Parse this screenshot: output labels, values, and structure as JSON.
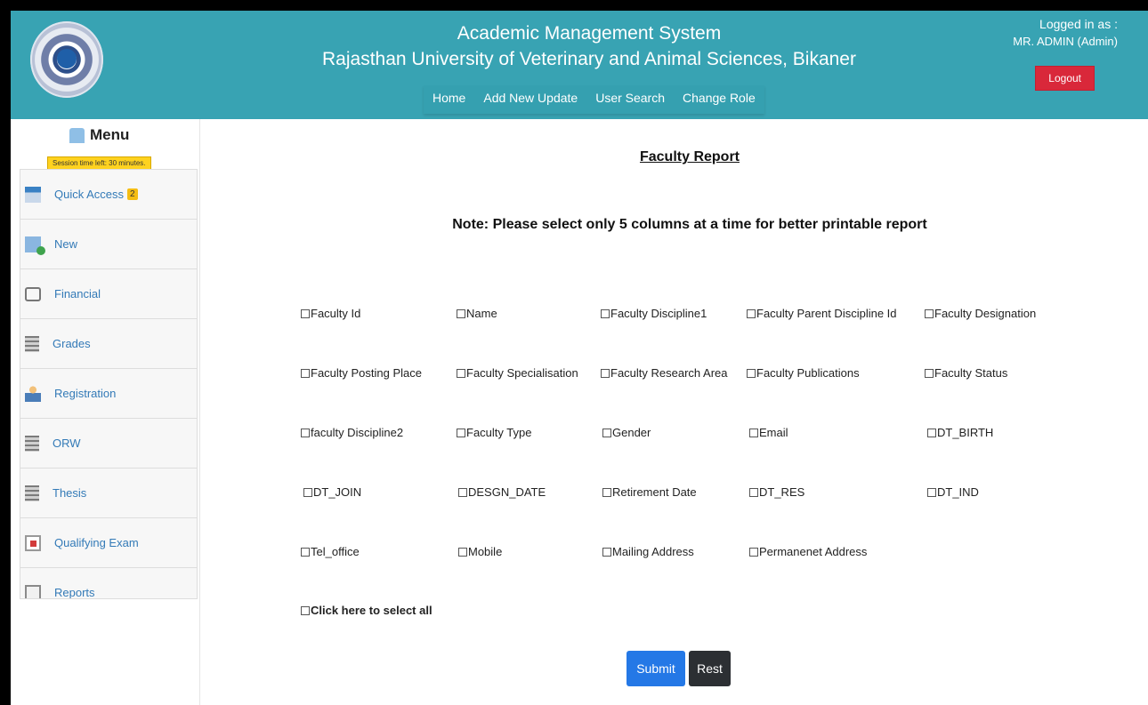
{
  "header": {
    "title_line1": "Academic Management System",
    "title_line2": "Rajasthan University of Veterinary and Animal Sciences, Bikaner",
    "nav": [
      "Home",
      "Add New Update",
      "User Search",
      "Change Role"
    ],
    "login_label": "Logged in as :",
    "user": "MR. ADMIN (Admin)",
    "logout": "Logout"
  },
  "sidebar": {
    "menu_title": "Menu",
    "session_text": "Session time left: 30 minutes.",
    "items": [
      {
        "label": "Quick Access",
        "badge": "2",
        "icon": "quick-access-icon"
      },
      {
        "label": "New",
        "icon": "new-icon"
      },
      {
        "label": "Financial",
        "icon": "bag-icon"
      },
      {
        "label": "Grades",
        "icon": "sheet-icon"
      },
      {
        "label": "Registration",
        "icon": "person-icon"
      },
      {
        "label": "ORW",
        "icon": "sheet-icon"
      },
      {
        "label": "Thesis",
        "icon": "sheet-icon"
      },
      {
        "label": "Qualifying Exam",
        "icon": "exam-icon"
      },
      {
        "label": "Reports",
        "icon": "report-icon"
      }
    ]
  },
  "main": {
    "title": "Faculty Report",
    "note": "Note: Please select only 5 columns at a time for better printable report",
    "options": [
      "Faculty Id",
      "Name",
      "Faculty Discipline1",
      "Faculty Parent Discipline Id",
      "Faculty Designation",
      "Faculty Posting Place",
      "Faculty Specialisation",
      "Faculty Research Area",
      "Faculty Publications",
      "Faculty Status",
      "faculty Discipline2",
      "Faculty Type",
      "Gender",
      "Email",
      "DT_BIRTH",
      "DT_JOIN",
      "DESGN_DATE",
      "Retirement Date",
      "DT_RES",
      "DT_IND",
      "Tel_office",
      "Mobile",
      "Mailing Address",
      "Permanenet Address"
    ],
    "select_all": "Click here to select all",
    "submit": "Submit",
    "reset": "Rest"
  }
}
